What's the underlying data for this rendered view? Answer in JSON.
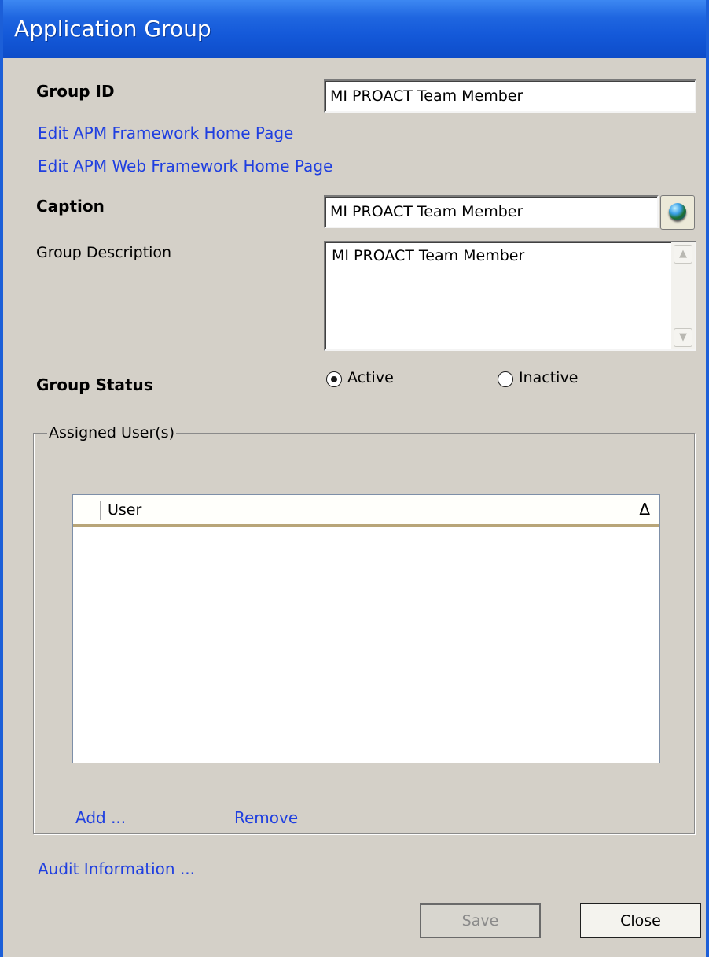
{
  "window": {
    "title": "Application Group"
  },
  "form": {
    "group_id_label": "Group ID",
    "group_id_value": "MI PROACT Team Member",
    "edit_home_link": "Edit APM Framework Home Page",
    "edit_web_home_link": "Edit APM Web Framework Home Page",
    "caption_label": "Caption",
    "caption_value": "MI PROACT Team Member",
    "description_label": "Group Description",
    "description_value": "MI PROACT Team Member",
    "status_label": "Group Status",
    "status_options": [
      {
        "label": "Active",
        "selected": true
      },
      {
        "label": "Inactive",
        "selected": false
      }
    ]
  },
  "assigned_users": {
    "legend": "Assigned User(s)",
    "columns": [
      {
        "label": "User",
        "sort": "ascending"
      }
    ],
    "rows": [],
    "add_link": "Add ...",
    "remove_link": "Remove"
  },
  "audit_link": "Audit Information ...",
  "buttons": {
    "save": "Save",
    "close": "Close"
  },
  "icons": {
    "globe": "globe-icon",
    "sort": "sort-ascending-icon",
    "scroll_up": "scroll-up-icon",
    "scroll_down": "scroll-down-icon"
  },
  "colors": {
    "titlebar": "#1f66e0",
    "link": "#1f3fe0",
    "background": "#d4d0c8"
  }
}
